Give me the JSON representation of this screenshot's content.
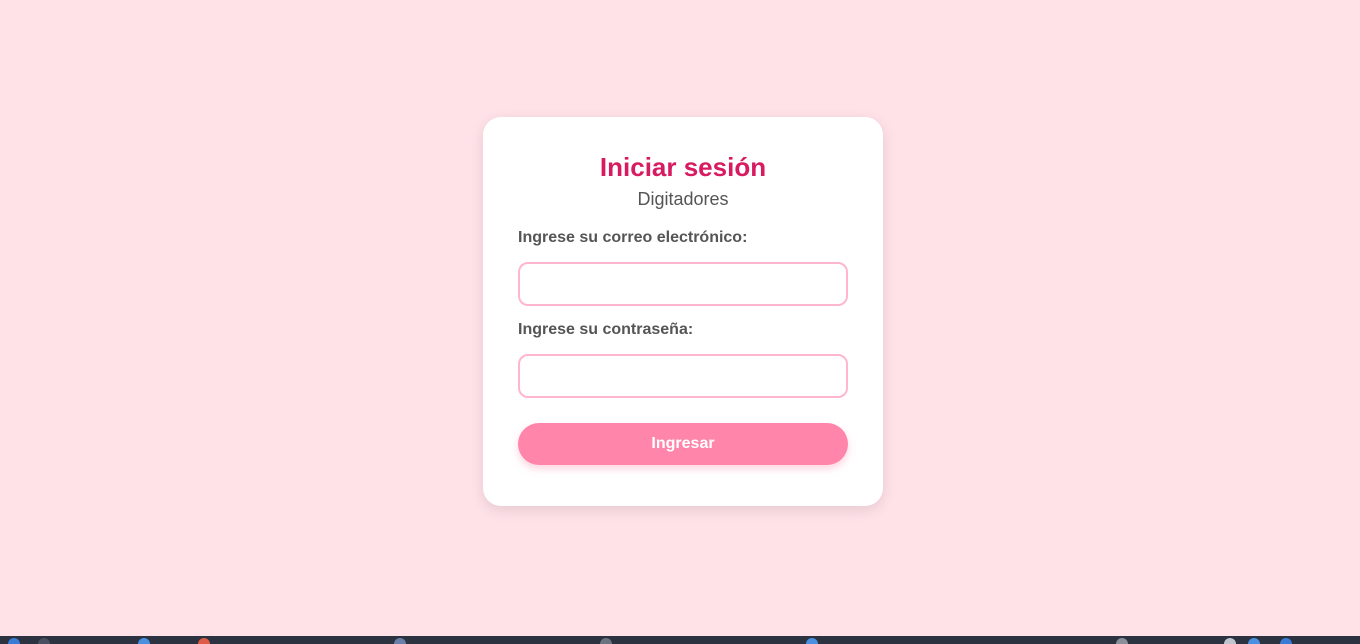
{
  "login": {
    "title": "Iniciar sesión",
    "subtitle": "Digitadores",
    "email_label": "Ingrese su correo electrónico:",
    "email_value": "",
    "password_label": "Ingrese su contraseña:",
    "password_value": "",
    "submit_label": "Ingresar"
  },
  "colors": {
    "background": "#ffe1e8",
    "card": "#ffffff",
    "title": "#d81b60",
    "input_border": "#ffb6d0",
    "button": "#ff85aa",
    "taskbar": "#2c3240"
  }
}
